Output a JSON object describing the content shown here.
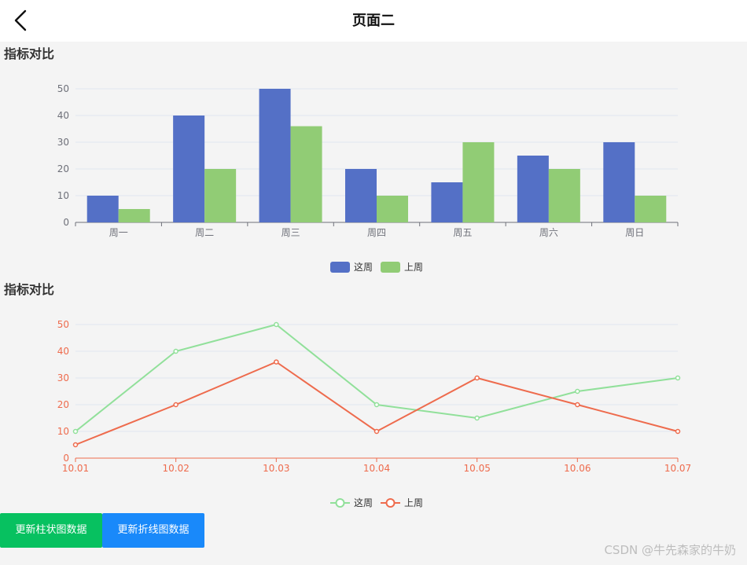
{
  "header": {
    "title": "页面二",
    "back_icon": "chevron-left-icon"
  },
  "section1": {
    "title": "指标对比"
  },
  "section2": {
    "title": "指标对比"
  },
  "buttons": {
    "bar_update": "更新柱状图数据",
    "line_update": "更新折线图数据"
  },
  "watermark": "CSDN @牛先森家的牛奶",
  "colors": {
    "this_week_bar": "#5470c6",
    "last_week_bar": "#91cc75",
    "this_week_line": "#91e09a",
    "last_week_line": "#ee6b4d",
    "green_button": "#07c160",
    "blue_button": "#1989fa"
  },
  "chart_data": [
    {
      "type": "bar",
      "categories": [
        "周一",
        "周二",
        "周三",
        "周四",
        "周五",
        "周六",
        "周日"
      ],
      "series": [
        {
          "name": "这周",
          "values": [
            10,
            40,
            50,
            20,
            15,
            25,
            30
          ]
        },
        {
          "name": "上周",
          "values": [
            5,
            20,
            36,
            10,
            30,
            20,
            10
          ]
        }
      ],
      "yticks": [
        0,
        10,
        20,
        30,
        40,
        50
      ],
      "ylim": [
        0,
        50
      ],
      "grid": true,
      "legend": "bottom-center"
    },
    {
      "type": "line",
      "categories": [
        "10.01",
        "10.02",
        "10.03",
        "10.04",
        "10.05",
        "10.06",
        "10.07"
      ],
      "series": [
        {
          "name": "这周",
          "values": [
            10,
            40,
            50,
            20,
            15,
            25,
            30
          ]
        },
        {
          "name": "上周",
          "values": [
            5,
            20,
            36,
            10,
            30,
            20,
            10
          ]
        }
      ],
      "yticks": [
        0,
        10,
        20,
        30,
        40,
        50
      ],
      "ylim": [
        0,
        50
      ],
      "grid": true,
      "legend": "bottom-center"
    }
  ]
}
